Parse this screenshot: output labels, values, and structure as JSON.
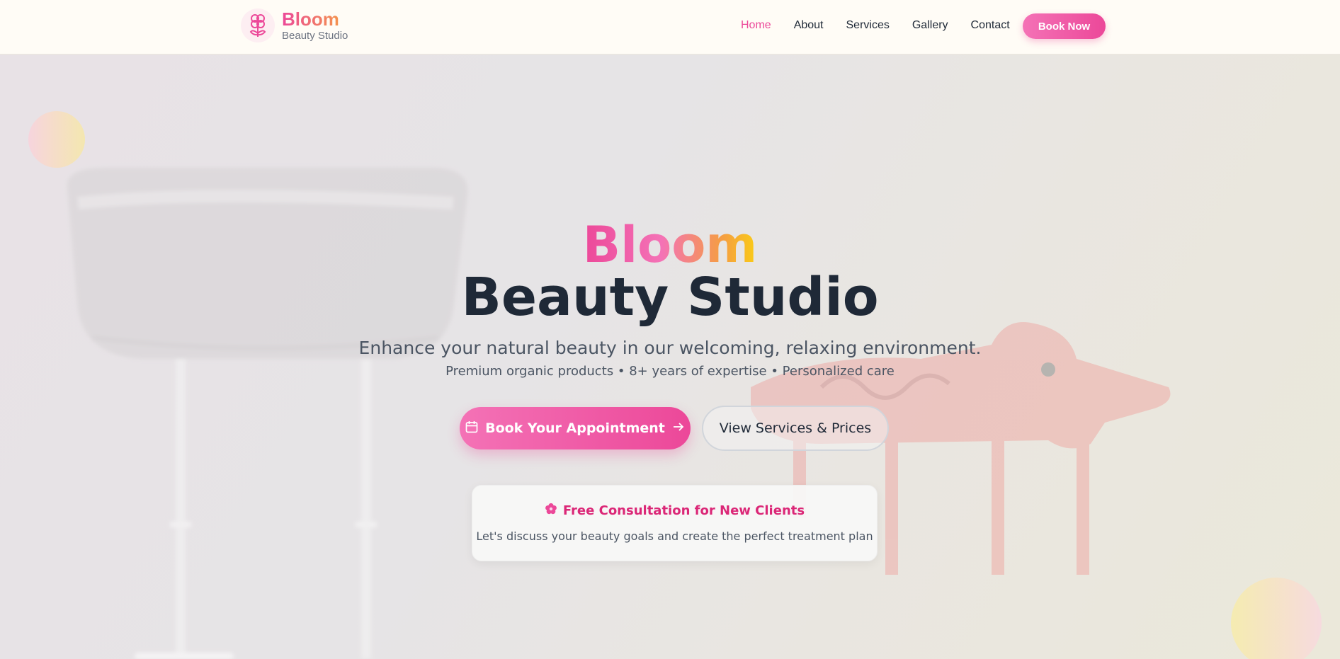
{
  "nav": {
    "brand_name": "Bloom",
    "brand_sub": "Beauty Studio",
    "links": [
      {
        "label": "Home",
        "active": true
      },
      {
        "label": "About",
        "active": false
      },
      {
        "label": "Services",
        "active": false
      },
      {
        "label": "Gallery",
        "active": false
      },
      {
        "label": "Contact",
        "active": false
      }
    ],
    "cta_label": "Book Now"
  },
  "hero": {
    "title_accent": "Bloom",
    "title_main": "Beauty Studio",
    "tagline": "Enhance your natural beauty in our welcoming, relaxing environment.",
    "sub_tagline": "Premium organic products • 8+ years of expertise • Personalized care",
    "primary_button": "Book Your Appointment",
    "secondary_button": "View Services & Prices"
  },
  "promo": {
    "title": "Free Consultation for New Clients",
    "text": "Let's discuss your beauty goals and create the perfect treatment plan"
  },
  "colors": {
    "brand_pink": "#ec4899",
    "brand_orange": "#f59e42",
    "text_dark": "#1f2937",
    "nav_bg": "#fffcf6"
  },
  "icons": {
    "logo": "flower-icon",
    "calendar": "calendar-icon",
    "arrow": "arrow-right-icon",
    "promo": "flower-icon"
  }
}
